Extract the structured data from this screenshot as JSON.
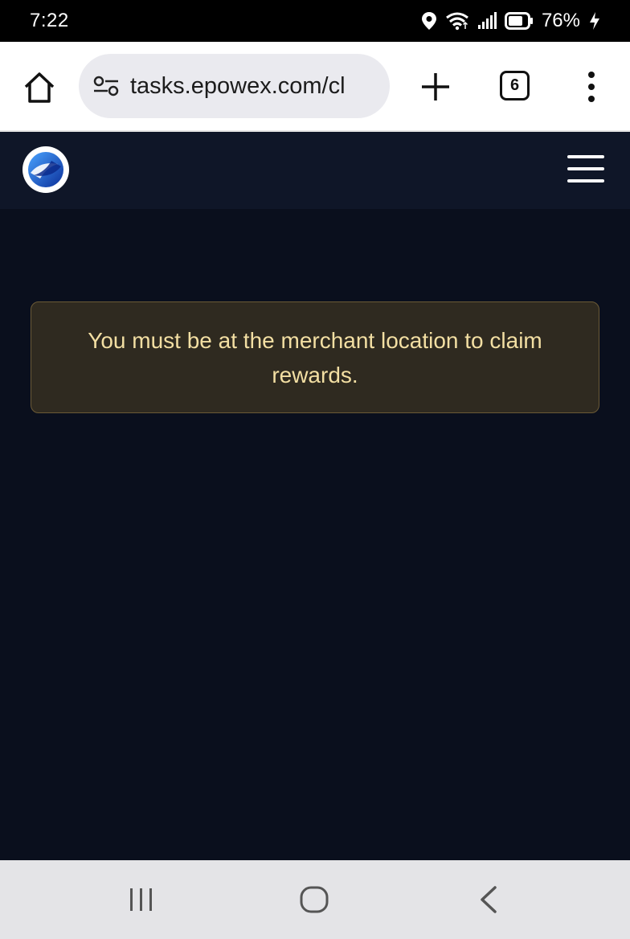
{
  "status_bar": {
    "time": "7:22",
    "battery_percent": "76%",
    "icons": [
      "location-icon",
      "wifi-icon",
      "signal-icon",
      "battery-icon",
      "charging-icon"
    ]
  },
  "browser": {
    "url": "tasks.epowex.com/cl",
    "tab_count": "6",
    "icons": [
      "home-icon",
      "site-settings-icon",
      "plus-icon",
      "tabs-icon",
      "more-vertical-icon"
    ]
  },
  "site": {
    "logo_icon": "epowex-logo-icon",
    "menu_icon": "hamburger-icon",
    "colors": {
      "header_bg": "#0f1628",
      "page_bg": "#0a0f1d",
      "alert_bg": "#2f2a20",
      "alert_border": "#6b5a36",
      "alert_text": "#f3dfa3"
    }
  },
  "alert": {
    "message": "You must be at the merchant location to claim rewards."
  },
  "nav_bar": {
    "icons": [
      "recents-icon",
      "home-circle-icon",
      "back-icon"
    ]
  }
}
